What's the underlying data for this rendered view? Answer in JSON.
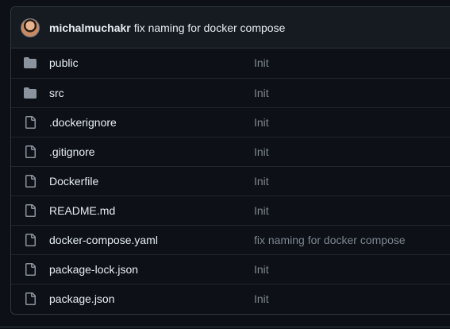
{
  "commit": {
    "author": "michalmuchakr",
    "message": "fix naming for docker compose"
  },
  "files": [
    {
      "name": "public",
      "type": "folder",
      "icon": "folder-icon",
      "commit": "Init"
    },
    {
      "name": "src",
      "type": "folder",
      "icon": "folder-icon",
      "commit": "Init"
    },
    {
      "name": ".dockerignore",
      "type": "file",
      "icon": "file-icon",
      "commit": "Init"
    },
    {
      "name": ".gitignore",
      "type": "file",
      "icon": "file-icon",
      "commit": "Init"
    },
    {
      "name": "Dockerfile",
      "type": "file",
      "icon": "file-icon",
      "commit": "Init"
    },
    {
      "name": "README.md",
      "type": "file",
      "icon": "file-icon",
      "commit": "Init"
    },
    {
      "name": "docker-compose.yaml",
      "type": "file",
      "icon": "file-icon",
      "commit": "fix naming for docker compose"
    },
    {
      "name": "package-lock.json",
      "type": "file",
      "icon": "file-icon",
      "commit": "Init"
    },
    {
      "name": "package.json",
      "type": "file",
      "icon": "file-icon",
      "commit": "Init"
    }
  ],
  "colors": {
    "background": "#0d1117",
    "border": "#30363d",
    "header_bg": "#161b22",
    "text": "#e6edf3",
    "muted": "#7d8590",
    "icon": "#8b949e"
  }
}
